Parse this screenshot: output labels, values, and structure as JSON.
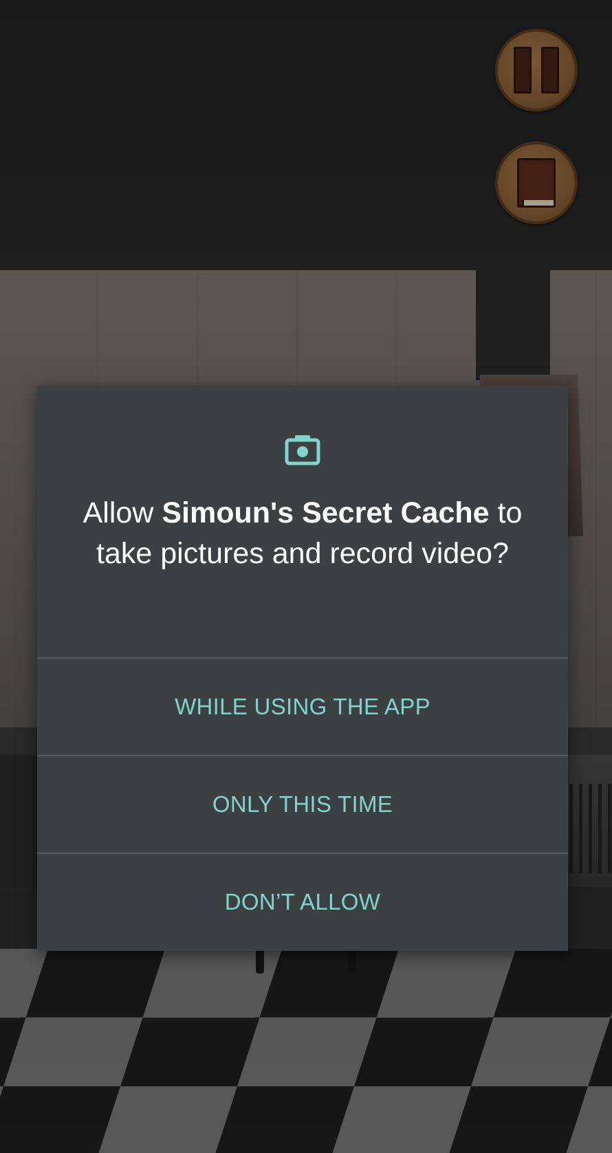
{
  "game": {
    "pause_icon": "pause-icon",
    "journal_icon": "book-icon",
    "button_color": "#8a6238"
  },
  "dialog": {
    "icon": "camera-icon",
    "message_prefix": "Allow ",
    "app_name": "Simoun's Secret Cache",
    "message_suffix": " to take pictures and record video?",
    "options": [
      "WHILE USING THE APP",
      "ONLY THIS TIME",
      "DON’T ALLOW"
    ],
    "background_color": "#3c4043",
    "accent_color": "#81d4c9"
  }
}
